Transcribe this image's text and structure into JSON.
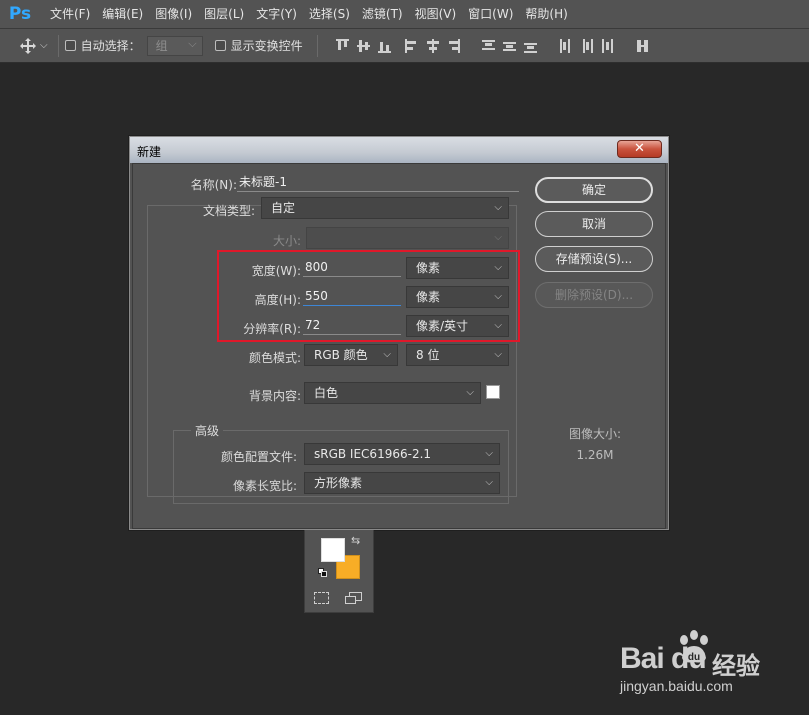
{
  "app": {
    "logo": "Ps"
  },
  "menu": [
    "文件(F)",
    "编辑(E)",
    "图像(I)",
    "图层(L)",
    "文字(Y)",
    "选择(S)",
    "滤镜(T)",
    "视图(V)",
    "窗口(W)",
    "帮助(H)"
  ],
  "options_bar": {
    "auto_select_label": "自动选择：",
    "auto_select_value": "组",
    "show_transform_label": "显示变换控件"
  },
  "dialog": {
    "title": "新建",
    "close_glyph": "✕",
    "name_label": "名称(N):",
    "name_value": "未标题-1",
    "doc_type_label": "文档类型:",
    "doc_type_value": "自定",
    "size_label": "大小:",
    "width_label": "宽度(W):",
    "width_value": "800",
    "width_unit": "像素",
    "height_label": "高度(H):",
    "height_value": "550",
    "height_unit": "像素",
    "resolution_label": "分辨率(R):",
    "resolution_value": "72",
    "resolution_unit": "像素/英寸",
    "color_mode_label": "颜色模式:",
    "color_mode_value": "RGB 颜色",
    "bit_depth_value": "8 位",
    "background_label": "背景内容:",
    "background_value": "白色",
    "advanced_label": "高级",
    "color_profile_label": "颜色配置文件:",
    "color_profile_value": "sRGB IEC61966-2.1",
    "pixel_aspect_label": "像素长宽比:",
    "pixel_aspect_value": "方形像素",
    "ok_button": "确定",
    "cancel_button": "取消",
    "save_preset_button": "存储预设(S)...",
    "delete_preset_button": "删除预设(D)...",
    "image_size_label": "图像大小:",
    "image_size_value": "1.26M"
  },
  "colors": {
    "foreground": "#ffffff",
    "background": "#f8ad26",
    "highlight": "#e0182a"
  },
  "watermark": {
    "brand": "Bai  du",
    "cn": "经验",
    "url": "jingyan.baidu.com"
  }
}
